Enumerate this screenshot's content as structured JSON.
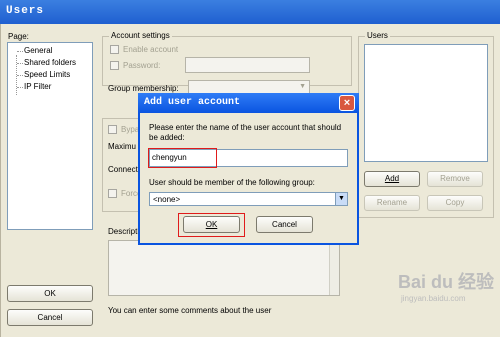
{
  "window": {
    "title": "Users"
  },
  "page_panel": {
    "label": "Page:",
    "items": [
      "General",
      "Shared folders",
      "Speed Limits",
      "IP Filter"
    ]
  },
  "account_settings": {
    "caption": "Account settings",
    "enable_account": "Enable account",
    "password": "Password:",
    "group_membership": "Group membership:",
    "bypass_fragment": "Bypa",
    "maximum_fragment": "Maximu",
    "connect_fragment": "Connect",
    "force_fragment": "Force",
    "description_fragment": "Descripti",
    "description_hint": "You can enter some comments about the user"
  },
  "users_panel": {
    "caption": "Users",
    "add": "Add",
    "remove": "Remove",
    "rename": "Rename",
    "copy": "Copy"
  },
  "main_buttons": {
    "ok": "OK",
    "cancel": "Cancel"
  },
  "dialog": {
    "title": "Add user account",
    "close_glyph": "×",
    "prompt": "Please enter the name of the user account that should be added:",
    "name_value": "chengyun",
    "group_label": "User should be member of the following group:",
    "group_value": "<none>",
    "ok": "OK",
    "cancel": "Cancel"
  },
  "watermark": {
    "brand": "Bai du 经验",
    "url": "jingyan.baidu.com"
  },
  "colors": {
    "accent_red": "#e01b1b",
    "title_blue": "#1f5fd0"
  },
  "icons": [
    "close-icon",
    "chevron-down-icon"
  ]
}
